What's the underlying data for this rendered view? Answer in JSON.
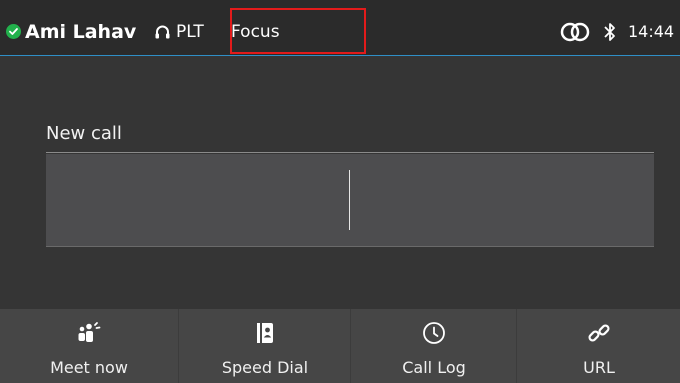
{
  "status": {
    "user_name": "Ami Lahav",
    "presence_color": "#22b14c",
    "device": "PLT",
    "mode": "Focus",
    "time": "14:44",
    "icons": [
      "check-icon",
      "headset-icon",
      "rings-icon",
      "bluetooth-icon"
    ]
  },
  "dialer": {
    "title": "New call",
    "input_value": ""
  },
  "softkeys": [
    {
      "label": "Meet now",
      "icon": "meet-now-icon"
    },
    {
      "label": "Speed Dial",
      "icon": "speed-dial-icon"
    },
    {
      "label": "Call Log",
      "icon": "clock-icon"
    },
    {
      "label": "URL",
      "icon": "link-icon"
    }
  ],
  "colors": {
    "accent": "#2f8fc7",
    "highlight": "#e21b1b"
  }
}
